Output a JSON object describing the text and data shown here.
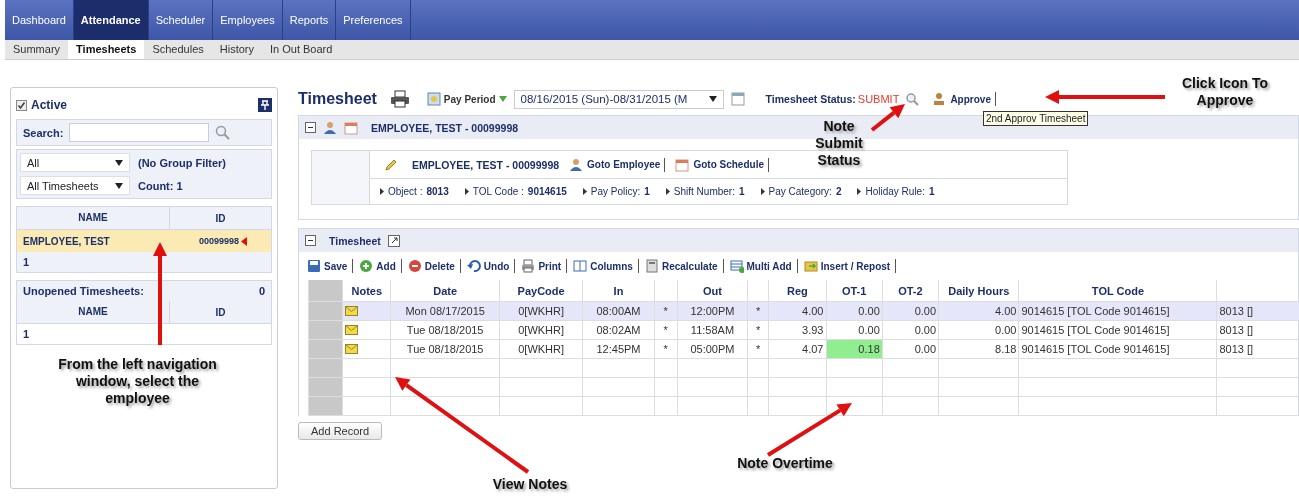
{
  "nav": {
    "tabs": [
      {
        "label": "Dashboard",
        "selected": false
      },
      {
        "label": "Attendance",
        "selected": true
      },
      {
        "label": "Scheduler",
        "selected": false
      },
      {
        "label": "Employees",
        "selected": false
      },
      {
        "label": "Reports",
        "selected": false
      },
      {
        "label": "Preferences",
        "selected": false
      }
    ]
  },
  "subnav": {
    "tabs": [
      {
        "label": "Summary",
        "selected": false
      },
      {
        "label": "Timesheets",
        "selected": true
      },
      {
        "label": "Schedules",
        "selected": false
      },
      {
        "label": "History",
        "selected": false
      },
      {
        "label": "In Out Board",
        "selected": false
      }
    ]
  },
  "sidebar": {
    "active": {
      "label": "Active",
      "checked": true
    },
    "search": {
      "label": "Search:"
    },
    "group_filter": {
      "value": "All",
      "note": "(No Group Filter)"
    },
    "sheet_filter": {
      "value": "All Timesheets",
      "count": "Count: 1"
    },
    "employees": {
      "columns": [
        "NAME",
        "ID"
      ],
      "rows": [
        {
          "name": "EMPLOYEE, TEST",
          "id": "00099998",
          "selected": true
        }
      ],
      "footer": "1"
    },
    "unopened": {
      "label": "Unopened Timesheets:",
      "count": "0",
      "columns": [
        "NAME",
        "ID"
      ],
      "footer": "1"
    }
  },
  "header": {
    "title": "Timesheet",
    "pay_period": "Pay Period",
    "period": "08/16/2015 (Sun)-08/31/2015 (M",
    "status_label": "Timesheet Status:",
    "status": "SUBMIT",
    "approve": "Approve",
    "tooltip": "2nd Approv Timesheet"
  },
  "employee_panel": {
    "title": "EMPLOYEE, TEST - 00099998",
    "name": "EMPLOYEE, TEST - 00099998",
    "links": [
      {
        "label": "Goto Employee",
        "kind": "person"
      },
      {
        "label": "Goto Schedule",
        "kind": "calendar"
      }
    ],
    "fields": [
      {
        "label": "Object :",
        "value": "8013"
      },
      {
        "label": "TOL Code :",
        "value": "9014615"
      },
      {
        "label": "Pay Policy:",
        "value": "1"
      },
      {
        "label": "Shift Number:",
        "value": "1"
      },
      {
        "label": "Pay Category:",
        "value": "2"
      },
      {
        "label": "Holiday Rule:",
        "value": "1"
      }
    ]
  },
  "timesheet": {
    "title": "Timesheet",
    "toolbar": [
      {
        "label": "Save",
        "kind": "save"
      },
      {
        "label": "Add",
        "kind": "add"
      },
      {
        "label": "Delete",
        "kind": "delete"
      },
      {
        "label": "Undo",
        "kind": "undo"
      },
      {
        "label": "Print",
        "kind": "print"
      },
      {
        "label": "Columns",
        "kind": "columns"
      },
      {
        "label": "Recalculate",
        "kind": "calc"
      },
      {
        "label": "Multi Add",
        "kind": "multi"
      },
      {
        "label": "Insert / Repost",
        "kind": "insert"
      }
    ],
    "columns": [
      "Notes",
      "Date",
      "PayCode",
      "In",
      "",
      "Out",
      "",
      "Reg",
      "OT-1",
      "OT-2",
      "Daily Hours",
      "TOL Code",
      ""
    ],
    "rows": [
      {
        "selected": true,
        "has_note": true,
        "date": "Mon 08/17/2015",
        "paycode": "0[WKHR]",
        "in": "08:00AM",
        "in_mark": "*",
        "out": "12:00PM",
        "out_mark": "*",
        "reg": "4.00",
        "ot1": "0.00",
        "ot1_flag": false,
        "ot2": "0.00",
        "daily": "4.00",
        "tol": "9014615 [TOL Code 9014615]",
        "extra": "8013 []"
      },
      {
        "selected": false,
        "has_note": true,
        "date": "Tue 08/18/2015",
        "paycode": "0[WKHR]",
        "in": "08:02AM",
        "in_mark": "*",
        "out": "11:58AM",
        "out_mark": "*",
        "reg": "3.93",
        "ot1": "0.00",
        "ot1_flag": false,
        "ot2": "0.00",
        "daily": "0.00",
        "tol": "9014615 [TOL Code 9014615]",
        "extra": "8013 []"
      },
      {
        "selected": false,
        "has_note": true,
        "date": "Tue 08/18/2015",
        "paycode": "0[WKHR]",
        "in": "12:45PM",
        "in_mark": "*",
        "out": "05:00PM",
        "out_mark": "*",
        "reg": "4.07",
        "ot1": "0.18",
        "ot1_flag": true,
        "ot2": "0.00",
        "daily": "8.18",
        "tol": "9014615 [TOL Code 9014615]",
        "extra": "8013 []"
      }
    ],
    "add_button": "Add Record"
  },
  "annotations": [
    {
      "text": "Click Icon To Approve"
    },
    {
      "text": "Note Submit Status"
    },
    {
      "text": "From the left navigation window, select the employee"
    },
    {
      "text": "View Notes"
    },
    {
      "text": "Note Overtime"
    }
  ]
}
